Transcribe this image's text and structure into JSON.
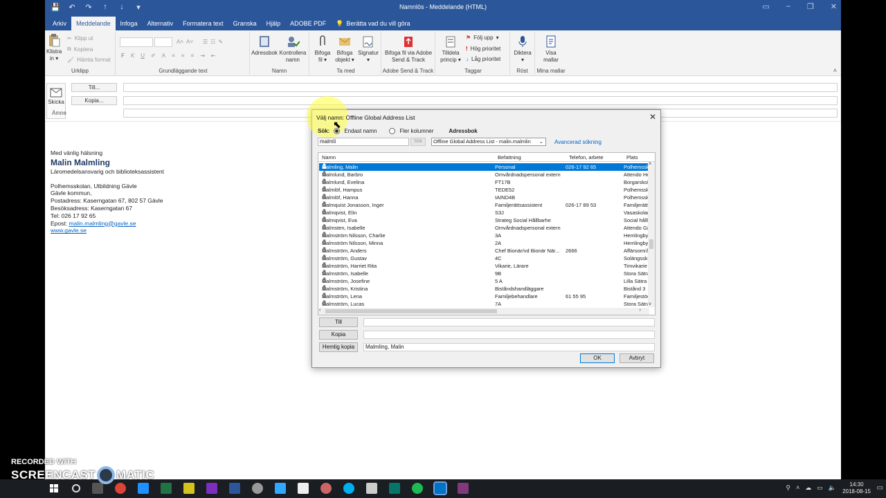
{
  "window": {
    "title": "Namnlös  -  Meddelande (HTML)",
    "controls": [
      "▭",
      "–",
      "❐",
      "✕"
    ]
  },
  "ribbon": {
    "tabs": [
      "Arkiv",
      "Meddelande",
      "Infoga",
      "Alternativ",
      "Formatera text",
      "Granska",
      "Hjälp",
      "ADOBE PDF"
    ],
    "tell_me": "Berätta vad du vill göra",
    "clipboard": {
      "paste": "Klistra",
      "paste2": "in",
      "cut": "Klipp ut",
      "copy": "Kopiera",
      "format_painter": "Hämta format",
      "label": "Urklipp"
    },
    "basic_text": {
      "label": "Grundläggande text",
      "bold": "F",
      "italic": "K",
      "underline": "U"
    },
    "names": {
      "address_book": "Adressbok",
      "check_names": "Kontrollera",
      "check_names2": "namn",
      "label": "Namn"
    },
    "include": {
      "attach_file": "Bifoga",
      "attach_file2": "fil",
      "attach_item": "Bifoga",
      "attach_item2": "objekt",
      "signature": "Signatur",
      "label": "Ta med"
    },
    "adobe": {
      "attach_adobe": "Bifoga fil via Adobe",
      "attach_adobe2": "Send & Track",
      "label": "Adobe Send & Track"
    },
    "tags": {
      "assign_policy": "Tilldela",
      "assign_policy2": "princip",
      "follow_up": "Följ upp",
      "high_priority": "Hög prioritet",
      "low_priority": "Låg prioritet",
      "label": "Taggar"
    },
    "voice": {
      "dictate": "Diktera",
      "label": "Röst"
    },
    "templates": {
      "view": "Visa",
      "view2": "mallar",
      "label": "Mina mallar"
    }
  },
  "compose": {
    "send": "Skicka",
    "to_btn": "Till...",
    "cc_btn": "Kopia...",
    "subject_label": "Ämne"
  },
  "signature": {
    "greeting": "Med vänlig hälsning",
    "name": "Malin Malmling",
    "role": "Läromedelsansvarig och biblioteksassistent",
    "org": "Polhemsskolan, Utbildning Gävle",
    "municipality": "Gävle kommun,",
    "postal": "Postadress: Kaserngatan 67, 802 57 Gävle",
    "visit": "Besöksadress: Kaserngatan 67",
    "phone": "Tel: 026 17 92 65",
    "email_label": "Epost: ",
    "email": "malin.malmling@gavle.se",
    "web": "www.gavle.se"
  },
  "dialog": {
    "title": "Välj namn: Offline Global Address List",
    "search_label": "Sök:",
    "radio_name_only": "Endast namn",
    "radio_more_cols": "Fler kolumner",
    "address_book_label": "Adressbok",
    "search_value": "malmli",
    "search_btn": "Sök",
    "address_book_value": "Offline Global Address List - malin.malmlin",
    "advanced": "Avancerad sökning",
    "columns": [
      "Namn",
      "Befattning",
      "Telefon, arbete",
      "Plats"
    ],
    "rows": [
      {
        "name": "Malmling, Malin",
        "title": "Personal",
        "phone": "026-17 92 65",
        "place": "Polhemsskolan"
      },
      {
        "name": "Malmlund, Barbro",
        "title": "Omvårdnadspersonal extern",
        "phone": "",
        "place": "Attendo Hemtj"
      },
      {
        "name": "Malmlund, Evelina",
        "title": "FT17B",
        "phone": "",
        "place": "Borgarskolan"
      },
      {
        "name": "Malmlöf, Hampus",
        "title": "TEDE52",
        "phone": "",
        "place": "Polhemsskolan"
      },
      {
        "name": "Malmlöf, Hanna",
        "title": "IAIND4B",
        "phone": "",
        "place": "Polhemsskolan"
      },
      {
        "name": "Malmquist Jonasson, Inger",
        "title": "Familjerättsassistent",
        "phone": "026-17 89 53",
        "place": "Familjerätt"
      },
      {
        "name": "Malmqvist, Elin",
        "title": "S3J",
        "phone": "",
        "place": "Vasaskolan"
      },
      {
        "name": "Malmqvist, Eva",
        "title": "Strateg Social Hållbarhe",
        "phone": "",
        "place": "Social hållbarh"
      },
      {
        "name": "Malmsten, Isabelle",
        "title": "Omvårdnadspersonal extern",
        "phone": "",
        "place": "Attendo Gävle"
      },
      {
        "name": "Malmström Nilsson, Charlie",
        "title": "3A",
        "phone": "",
        "place": "Hemlingby"
      },
      {
        "name": "Malmström Nilsson, Minna",
        "title": "2A",
        "phone": "",
        "place": "Hemlingby"
      },
      {
        "name": "Malmström, Anders",
        "title": "Chef Bionär/vd Bionär När...",
        "phone": "2666",
        "place": "Affärsområde"
      },
      {
        "name": "Malmström, Gustav",
        "title": "4C",
        "phone": "",
        "place": "Solängsskolan"
      },
      {
        "name": "Malmström, Harriet Rita",
        "title": "Vikarie, Lärare",
        "phone": "",
        "place": "Timvikarie"
      },
      {
        "name": "Malmström, Isabelle",
        "title": "9B",
        "phone": "",
        "place": "Stora Sätra"
      },
      {
        "name": "Malmström, Josefine",
        "title": "5 A",
        "phone": "",
        "place": "Lilla Sätra"
      },
      {
        "name": "Malmström, Kristina",
        "title": "Biståndshandläggare",
        "phone": "",
        "place": "Bistånd 3"
      },
      {
        "name": "Malmström, Lena",
        "title": "Familjebehandlare",
        "phone": "61 55 95",
        "place": "Familjestöd"
      },
      {
        "name": "Malmström, Lucas",
        "title": "7A",
        "phone": "",
        "place": "Stora Sätra"
      }
    ],
    "to_btn": "Till",
    "cc_btn": "Kopia",
    "bcc_btn": "Hemlig kopia",
    "to_value": "",
    "cc_value": "",
    "bcc_value": "Malmling, Malin",
    "ok": "OK",
    "cancel": "Avbryt"
  },
  "taskbar": {
    "time": "14:30",
    "date": "2018-08-15"
  },
  "watermark": {
    "line1": "RECORDED WITH",
    "line2a": "SCREENCAST",
    "line2b": "MATIC"
  },
  "colors": {
    "accent": "#2b579a",
    "selection": "#0078d7",
    "link": "#0563c1"
  }
}
